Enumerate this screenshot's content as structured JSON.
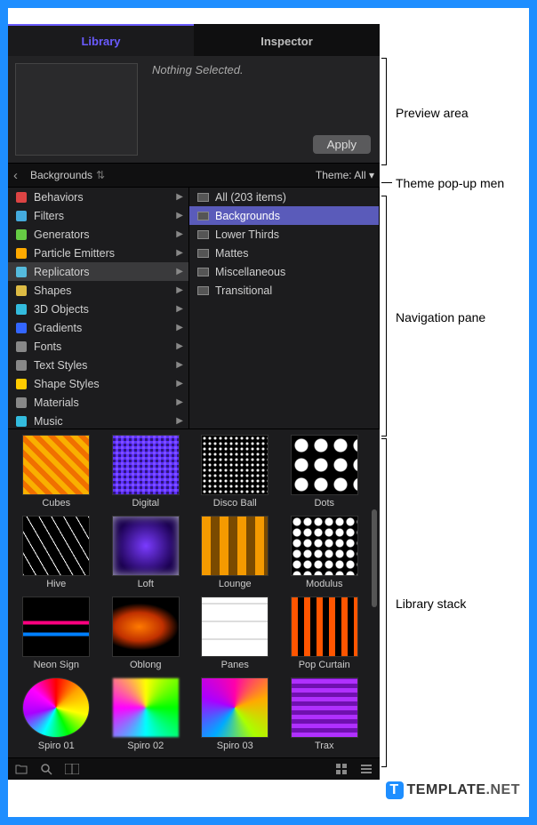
{
  "tabs": {
    "library": "Library",
    "inspector": "Inspector"
  },
  "preview": {
    "status": "Nothing Selected.",
    "apply": "Apply"
  },
  "pathbar": {
    "breadcrumb": "Backgrounds",
    "theme_label": "Theme: All"
  },
  "categories": [
    {
      "label": "Behaviors",
      "color": "#d44"
    },
    {
      "label": "Filters",
      "color": "#4ad"
    },
    {
      "label": "Generators",
      "color": "#6c4"
    },
    {
      "label": "Particle Emitters",
      "color": "#fa0"
    },
    {
      "label": "Replicators",
      "color": "#5bd",
      "highlighted": true
    },
    {
      "label": "Shapes",
      "color": "#db4"
    },
    {
      "label": "3D Objects",
      "color": "#3bd"
    },
    {
      "label": "Gradients",
      "color": "#36f"
    },
    {
      "label": "Fonts",
      "color": "#888"
    },
    {
      "label": "Text Styles",
      "color": "#888"
    },
    {
      "label": "Shape Styles",
      "color": "#fc0"
    },
    {
      "label": "Materials",
      "color": "#888"
    },
    {
      "label": "Music",
      "color": "#3bd"
    }
  ],
  "subcategories": [
    {
      "label": "All (203 items)"
    },
    {
      "label": "Backgrounds",
      "selected": true
    },
    {
      "label": "Lower Thirds"
    },
    {
      "label": "Mattes"
    },
    {
      "label": "Miscellaneous"
    },
    {
      "label": "Transitional"
    }
  ],
  "items": [
    {
      "label": "Cubes",
      "cls": "p-cubes"
    },
    {
      "label": "Digital",
      "cls": "p-digital"
    },
    {
      "label": "Disco Ball",
      "cls": "p-disco"
    },
    {
      "label": "Dots",
      "cls": "p-dots"
    },
    {
      "label": "Hive",
      "cls": "p-hive"
    },
    {
      "label": "Loft",
      "cls": "p-loft"
    },
    {
      "label": "Lounge",
      "cls": "p-lounge"
    },
    {
      "label": "Modulus",
      "cls": "p-modulus"
    },
    {
      "label": "Neon Sign",
      "cls": "p-neon"
    },
    {
      "label": "Oblong",
      "cls": "p-oblong"
    },
    {
      "label": "Panes",
      "cls": "p-panes"
    },
    {
      "label": "Pop Curtain",
      "cls": "p-curtain"
    },
    {
      "label": "Spiro 01",
      "cls": "p-spiro1"
    },
    {
      "label": "Spiro 02",
      "cls": "p-spiro2"
    },
    {
      "label": "Spiro 03",
      "cls": "p-spiro3"
    },
    {
      "label": "Trax",
      "cls": "p-trax"
    }
  ],
  "annotations": {
    "preview": "Preview area",
    "theme": "Theme pop-up men",
    "nav": "Navigation pane",
    "stack": "Library stack"
  },
  "watermark": {
    "logo": "T",
    "text": "TEMPLATE",
    "suffix": ".NET"
  }
}
